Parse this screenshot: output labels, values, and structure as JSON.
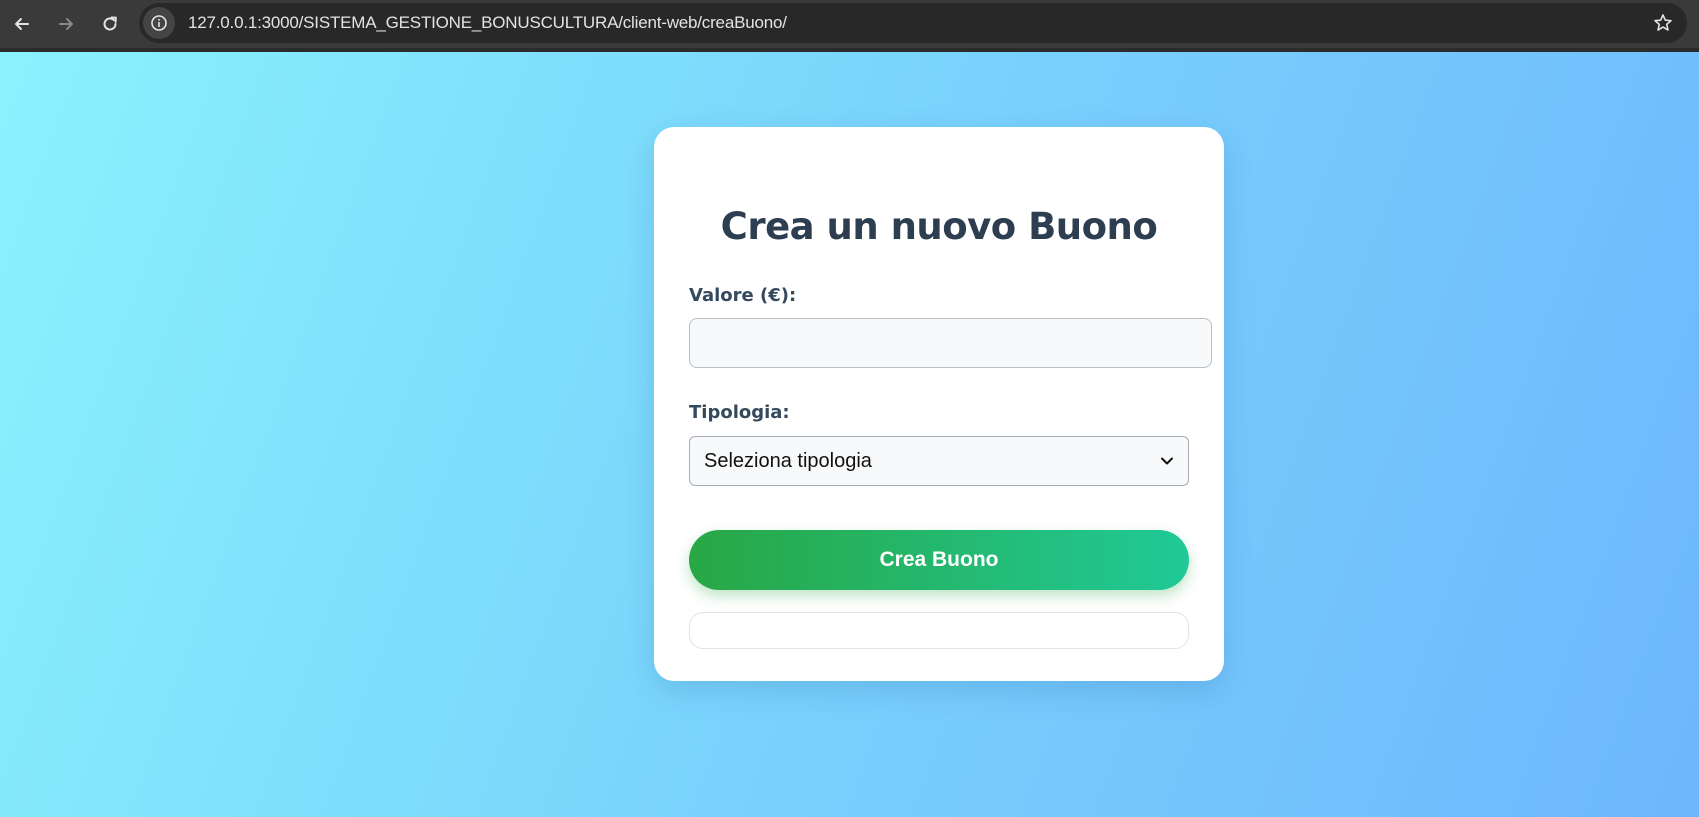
{
  "browser": {
    "url": "127.0.0.1:3000/SISTEMA_GESTIONE_BONUSCULTURA/client-web/creaBuono/",
    "icons": {
      "back": "back-arrow-icon",
      "forward": "forward-arrow-icon",
      "reload": "reload-icon",
      "site_info": "info-icon",
      "bookmark": "star-icon"
    }
  },
  "form": {
    "title": "Crea un nuovo Buono",
    "valore_label": "Valore (€):",
    "valore_value": "",
    "tipologia_label": "Tipologia:",
    "tipologia_selected": "Seleziona tipologia",
    "submit_label": "Crea Buono",
    "message": ""
  },
  "colors": {
    "title": "#2c3e50",
    "button_start": "#28a745",
    "button_end": "#20c997",
    "background_start": "#8af2fd",
    "background_end": "#6eb6fd"
  }
}
